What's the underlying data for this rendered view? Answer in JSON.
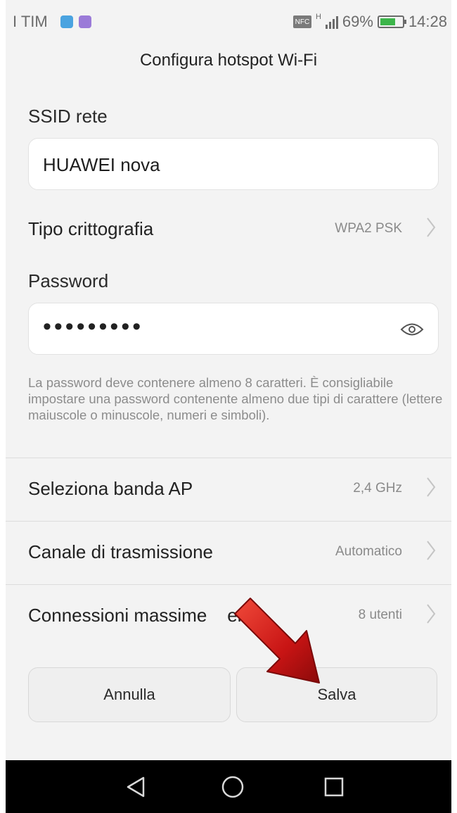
{
  "status_bar": {
    "carrier": "I TIM",
    "nfc": "NFC",
    "network": "H",
    "battery": "69%",
    "battery_level": 0.69,
    "time": "14:28"
  },
  "header": {
    "title": "Configura hotspot Wi-Fi"
  },
  "form": {
    "ssid_label": "SSID rete",
    "ssid_value": "HUAWEI nova",
    "encryption_label": "Tipo crittografia",
    "encryption_value": "WPA2 PSK",
    "password_label": "Password",
    "password_value": "•••••••••",
    "password_hint": "La password deve contenere almeno 8 caratteri. È consigliabile impostare una password contenente almeno due tipi di carattere (lettere maiuscole o minuscole, numeri e simboli).",
    "band_label": "Seleziona banda AP",
    "band_value": "2,4 GHz",
    "channel_label": "Canale di trasmissione",
    "channel_value": "Automatico",
    "max_conn_label": "Connessioni massime    en...",
    "max_conn_value": "8 utenti"
  },
  "buttons": {
    "cancel": "Annulla",
    "save": "Salva"
  },
  "icons": [
    "eye-icon",
    "chevron-right-icon",
    "back-icon",
    "home-icon",
    "recents-icon",
    "red-arrow-icon"
  ],
  "colors": {
    "arrow": "#d21e1e",
    "battery": "#3cb54a"
  }
}
